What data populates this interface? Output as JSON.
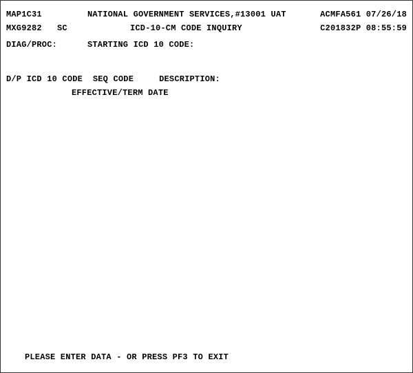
{
  "header": {
    "screen_id": "MAP1C31",
    "org_text": "NATIONAL GOVERNMENT SERVICES,#13001 UAT",
    "program_id": "ACMFA561",
    "date": "07/26/18",
    "txn_id": "MXG9282",
    "region": "SC",
    "title": "ICD-10-CM CODE INQUIRY",
    "sys_id": "C201832P",
    "time": "08:55:59"
  },
  "prompts": {
    "diag_proc_label": "DIAG/PROC:",
    "starting_code_label": "STARTING ICD 10 CODE:"
  },
  "columns": {
    "dp": "D/P",
    "icd10": "ICD 10 CODE",
    "seq": "SEQ",
    "code": "CODE",
    "description": "DESCRIPTION:",
    "eff_term": "EFFECTIVE/TERM DATE"
  },
  "footer": {
    "message": "PLEASE ENTER DATA - OR PRESS PF3 TO EXIT"
  }
}
